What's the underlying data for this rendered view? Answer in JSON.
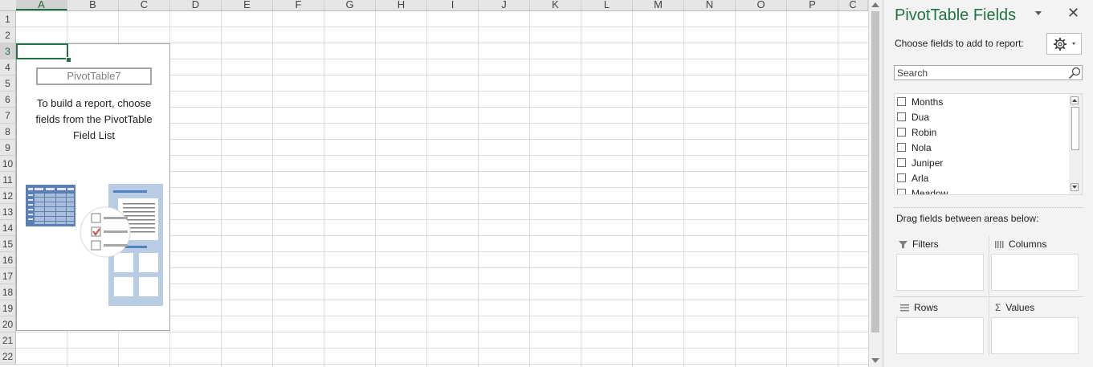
{
  "sheet": {
    "columns": [
      "A",
      "B",
      "C",
      "D",
      "E",
      "F",
      "G",
      "H",
      "I",
      "J",
      "K",
      "L",
      "M",
      "N",
      "O",
      "P",
      "C"
    ],
    "rows": [
      "1",
      "2",
      "3",
      "4",
      "5",
      "6",
      "7",
      "8",
      "9",
      "10",
      "11",
      "12",
      "13",
      "14",
      "15",
      "16",
      "17",
      "18",
      "19",
      "20",
      "21",
      "22"
    ],
    "selected_column": "A",
    "selected_row": "3"
  },
  "pivot_placeholder": {
    "name": "PivotTable7",
    "message": "To build a report, choose fields from the PivotTable Field List"
  },
  "pane": {
    "title": "PivotTable Fields",
    "choose_label": "Choose fields to add to report:",
    "search_placeholder": "Search",
    "fields": [
      {
        "label": "Months",
        "checked": false
      },
      {
        "label": "Dua",
        "checked": false
      },
      {
        "label": "Robin",
        "checked": false
      },
      {
        "label": "Nola",
        "checked": false
      },
      {
        "label": "Juniper",
        "checked": false
      },
      {
        "label": "Arla",
        "checked": false
      },
      {
        "label": "Meadow",
        "checked": false
      }
    ],
    "drag_label": "Drag fields between areas below:",
    "areas": {
      "filters": "Filters",
      "columns": "Columns",
      "rows": "Rows",
      "values": "Values"
    }
  },
  "colors": {
    "accent": "#217346"
  }
}
